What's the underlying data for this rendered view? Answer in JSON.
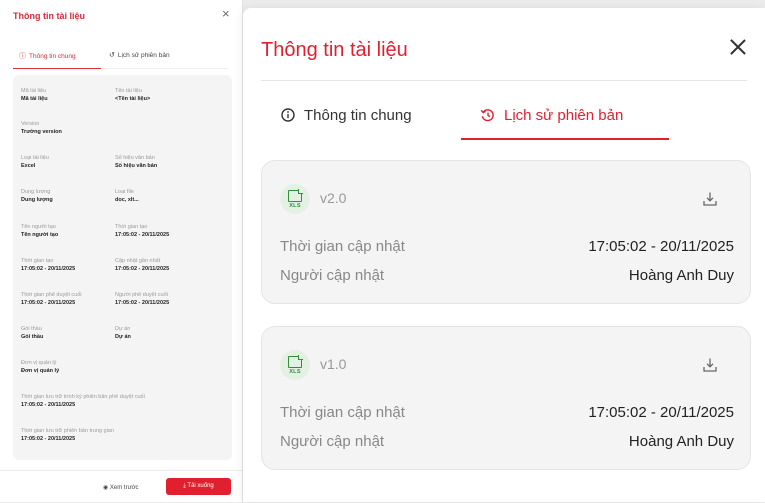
{
  "left_panel": {
    "title": "Thông tin tài liệu",
    "close": "×",
    "tabs": [
      {
        "label": "Thông tin chung",
        "icon": "info-icon"
      },
      {
        "label": "Lịch sử phiên bản",
        "icon": "history-icon"
      }
    ],
    "fields": [
      {
        "label": "Mã tài liệu",
        "value": "Mã tài liệu"
      },
      {
        "label": "Tên tài liệu",
        "value": "<Tên tài liệu>"
      },
      {
        "label": "Version",
        "value": "Trường version"
      },
      {
        "label": "Loại tài liệu",
        "value": "Excel"
      },
      {
        "label": "Số hiệu văn bản",
        "value": "Số hiệu văn bản"
      },
      {
        "label": "Dung lượng",
        "value": "Dung lượng"
      },
      {
        "label": "Loại file",
        "value": "doc, xlt..."
      },
      {
        "label": "Tên người tạo",
        "value": "Tên người tạo"
      },
      {
        "label": "Thời gian tạo",
        "value": "17:05:02 - 20/11/2025"
      },
      {
        "label": "Thời gian tạo",
        "value": "17:05:02 - 20/11/2025"
      },
      {
        "label": "Cập nhật gần nhất",
        "value": "17:05:02 - 20/11/2025"
      },
      {
        "label": "Thời gian phê duyệt cuối",
        "value": "17:05:02 - 20/11/2025"
      },
      {
        "label": "Người phê duyệt cuối",
        "value": "17:05:02 - 20/11/2025"
      },
      {
        "label": "Gói thầu",
        "value": "Gói thầu"
      },
      {
        "label": "Dự án",
        "value": "Dự án"
      },
      {
        "label": "Đơn vị quản lý",
        "value": "Đơn vị quản lý"
      },
      {
        "label": "Thời gian lưu trữ trình ký phiên bản phê duyệt cuối",
        "value": "17:05:02 - 20/11/2025"
      },
      {
        "label": "Thời gian lưu trữ phiên bản trung gian",
        "value": "17:05:02 - 20/11/2025"
      }
    ],
    "preview_label": "Xem trước",
    "download_label": "Tải xuống"
  },
  "modal": {
    "title": "Thông tin tài liệu",
    "tabs": [
      {
        "label": "Thông tin chung",
        "icon": "info-icon"
      },
      {
        "label": "Lịch sử phiên bản",
        "icon": "history-icon",
        "active": true
      }
    ],
    "versions": [
      {
        "version": "v2.0",
        "file_type": "XLS",
        "updated_time_label": "Thời gian cập nhật",
        "updated_time": "17:05:02 - 20/11/2025",
        "updated_by_label": "Người cập nhật",
        "updated_by": "Hoàng Anh Duy"
      },
      {
        "version": "v1.0",
        "file_type": "XLS",
        "updated_time_label": "Thời gian cập nhật",
        "updated_time": "17:05:02 - 20/11/2025",
        "updated_by_label": "Người cập nhật",
        "updated_by": "Hoàng Anh Duy"
      }
    ]
  },
  "colors": {
    "accent": "#e21f2f",
    "excel_green": "#2f8f3d"
  }
}
